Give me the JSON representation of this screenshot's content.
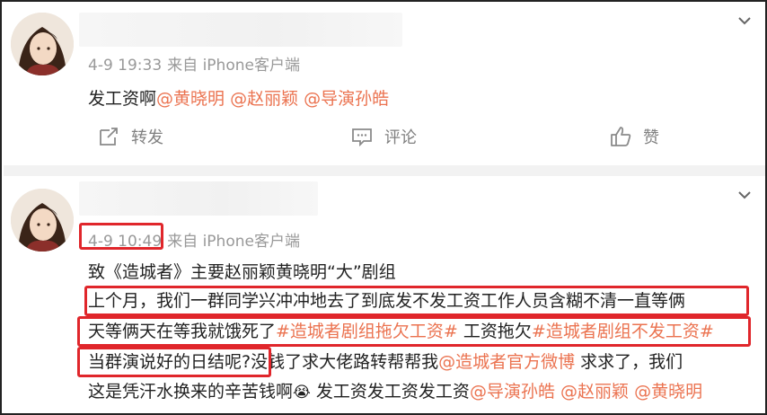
{
  "post1": {
    "time": "4-9 19:33",
    "source": "来自 iPhone客户端",
    "text_plain": "发工资啊",
    "mentions": [
      "@黄晓明",
      "@赵丽颖",
      "@导演孙皓"
    ]
  },
  "actions": {
    "repost": "转发",
    "comment": "评论",
    "like": "赞"
  },
  "post2": {
    "time": "4-9 10:49",
    "source": "来自 iPhone客户端",
    "line1": "致《造城者》主要赵丽颖黄晓明“大”剧组",
    "line2": "上个月，我们一群同学兴冲冲地去了到底发不发工资工作人员含糊不清一直等俩",
    "line3_a": "天等俩天在等我就饿死了",
    "line3_tag1": "#造城者剧组拖欠工资#",
    "line3_b": " 工资拖欠",
    "line3_tag2": "#造城者剧组不发工资#",
    "line4_a": "当群演说好的日结呢?",
    "line4_b": "没钱了求大佬路转帮帮我",
    "line4_mention": "@造城者官方微博",
    "line4_c": " 求求了，我们",
    "line5_a": "这是凭汗水换来的辛苦钱啊",
    "line5_emoji": "😭",
    "line5_b": " 发工资发工资发工资",
    "line5_mentions": [
      "@导演孙皓",
      "@赵丽颖",
      "@黄晓明"
    ]
  },
  "colors": {
    "link": "#eb7350",
    "highlight": "#e0262b",
    "meta": "#999999"
  }
}
